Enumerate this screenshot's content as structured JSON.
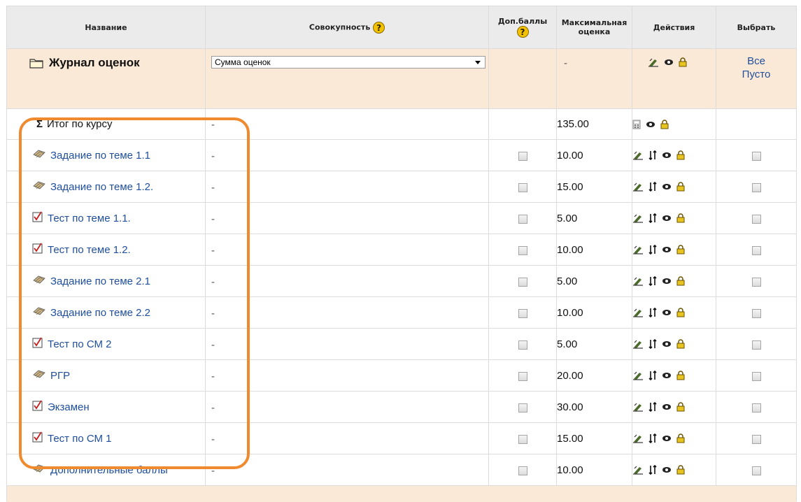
{
  "header": {
    "name": "Название",
    "aggregation": "Совокупность",
    "extra": "Доп.баллы",
    "max_grade_line1": "Максимальная",
    "max_grade_line2": "оценка",
    "actions": "Действия",
    "select": "Выбрать",
    "help_glyph": "?"
  },
  "category": {
    "name": "Журнал оценок",
    "aggregation_value": "Сумма оценок",
    "max": "-",
    "select_all": "Все",
    "select_none": "Пусто"
  },
  "total": {
    "label": "Итог по курсу",
    "aggregation": "-",
    "max": "135.00"
  },
  "items": [
    {
      "name": "Задание по теме 1.1",
      "type": "assignment",
      "aggregation": "-",
      "max": "10.00"
    },
    {
      "name": "Задание по теме 1.2.",
      "type": "assignment",
      "aggregation": "-",
      "max": "15.00"
    },
    {
      "name": "Тест по теме 1.1.",
      "type": "quiz",
      "aggregation": "-",
      "max": "5.00"
    },
    {
      "name": "Тест по теме 1.2.",
      "type": "quiz",
      "aggregation": "-",
      "max": "10.00"
    },
    {
      "name": "Задание по теме 2.1",
      "type": "assignment",
      "aggregation": "-",
      "max": "5.00"
    },
    {
      "name": "Задание по теме 2.2",
      "type": "assignment",
      "aggregation": "-",
      "max": "10.00"
    },
    {
      "name": "Тест по СМ 2",
      "type": "quiz",
      "aggregation": "-",
      "max": "5.00"
    },
    {
      "name": "РГР",
      "type": "assignment",
      "aggregation": "-",
      "max": "20.00"
    },
    {
      "name": "Экзамен",
      "type": "quiz",
      "aggregation": "-",
      "max": "30.00"
    },
    {
      "name": "Тест по СМ 1",
      "type": "quiz",
      "aggregation": "-",
      "max": "15.00"
    },
    {
      "name": "Дополнительные баллы",
      "type": "assignment",
      "aggregation": "-",
      "max": "10.00"
    }
  ],
  "colors": {
    "header_bg": "#ebebeb",
    "category_bg": "#fbe9d7",
    "link": "#1f4e9c",
    "highlight_outline": "#f08a2e"
  }
}
